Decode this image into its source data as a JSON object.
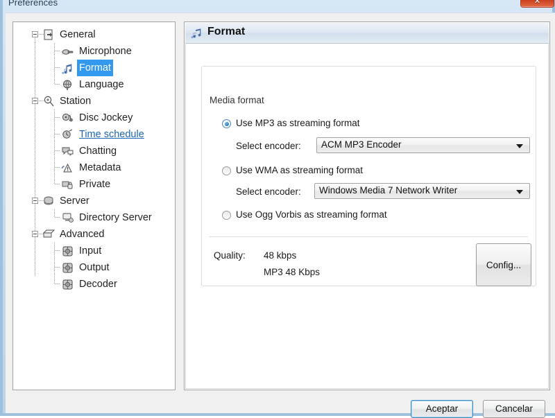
{
  "window": {
    "title": "Preferences",
    "close_label": "✕",
    "accent_selected": "#3399ee",
    "link_color": "#1a66b3"
  },
  "tree": {
    "items": [
      {
        "label": "General",
        "level": "root",
        "icon": "general-icon",
        "state": "expanded"
      },
      {
        "label": "Microphone",
        "level": "child",
        "icon": "microphone-icon",
        "state": "normal"
      },
      {
        "label": "Format",
        "level": "child",
        "icon": "music-note-icon",
        "state": "selected"
      },
      {
        "label": "Language",
        "level": "child",
        "icon": "globe-icon",
        "state": "normal"
      },
      {
        "label": "Station",
        "level": "root",
        "icon": "satellite-icon",
        "state": "expanded"
      },
      {
        "label": "Disc Jockey",
        "level": "child",
        "icon": "disc-jockey-icon",
        "state": "normal"
      },
      {
        "label": "Time schedule",
        "level": "child",
        "icon": "clock-icon",
        "state": "link"
      },
      {
        "label": "Chatting",
        "level": "child",
        "icon": "chat-icon",
        "state": "normal"
      },
      {
        "label": "Metadata",
        "level": "child",
        "icon": "metadata-icon",
        "state": "normal"
      },
      {
        "label": "Private",
        "level": "child",
        "icon": "private-lock-icon",
        "state": "normal"
      },
      {
        "label": "Server",
        "level": "root",
        "icon": "server-icon",
        "state": "expanded"
      },
      {
        "label": "Directory Server",
        "level": "child",
        "icon": "directory-server-icon",
        "state": "normal"
      },
      {
        "label": "Advanced",
        "level": "root",
        "icon": "advanced-icon",
        "state": "expanded"
      },
      {
        "label": "Input",
        "level": "child",
        "icon": "plugin-icon",
        "state": "normal"
      },
      {
        "label": "Output",
        "level": "child",
        "icon": "plugin-icon",
        "state": "normal"
      },
      {
        "label": "Decoder",
        "level": "child",
        "icon": "plugin-icon",
        "state": "normal"
      }
    ]
  },
  "panel": {
    "header_title": "Format",
    "header_icon": "music-note-icon",
    "groupbox_title": "Media format",
    "options": [
      {
        "label": "Use MP3 as streaming format",
        "selected": true
      },
      {
        "label": "Use WMA as streaming format",
        "selected": false
      },
      {
        "label": "Use Ogg Vorbis as streaming format",
        "selected": false
      }
    ],
    "encoder_mp3": {
      "label": "Select encoder:",
      "value": "ACM MP3 Encoder"
    },
    "encoder_wma": {
      "label": "Select encoder:",
      "value": "Windows Media 7 Network Writer"
    },
    "quality": {
      "label": "Quality:",
      "value": "48 kbps",
      "detail": "MP3 48 Kbps"
    },
    "config_button": "Config..."
  },
  "footer": {
    "ok_label": "Aceptar",
    "cancel_label": "Cancelar"
  }
}
